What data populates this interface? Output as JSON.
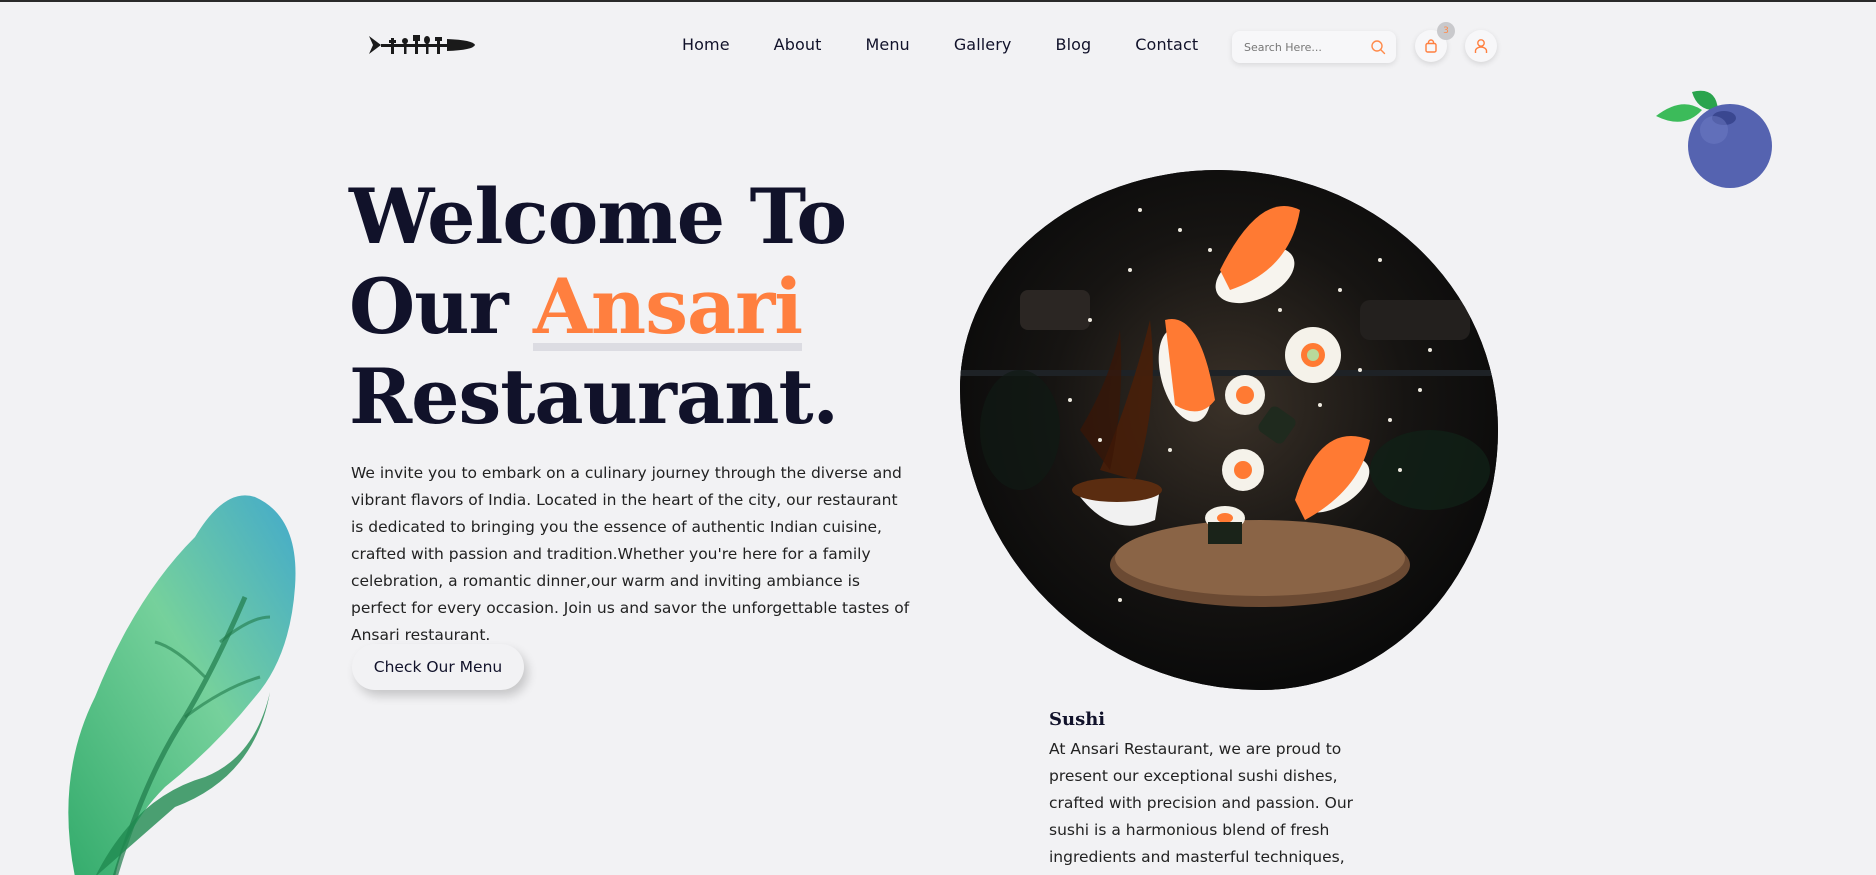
{
  "header": {
    "logo_icon": "utensils-logo-icon",
    "nav": [
      "Home",
      "About",
      "Menu",
      "Gallery",
      "Blog",
      "Contact"
    ],
    "search_placeholder": "Search Here...",
    "cart_count": "3"
  },
  "hero": {
    "title_line1": "Welcome To",
    "title_line2_prefix": "Our ",
    "title_accent": "Ansari",
    "title_line3": "Restaurant.",
    "description": "We invite you to embark on a culinary journey through the diverse and vibrant flavors of India. Located in the heart of the city, our restaurant is dedicated to bringing you the essence of authentic Indian cuisine, crafted with passion and tradition.Whether you're here for a family celebration, a romantic dinner,our warm and inviting ambiance is perfect for every occasion. Join us and savor the unforgettable tastes of Ansari restaurant.",
    "cta": "Check Our Menu"
  },
  "feature": {
    "title": "Sushi",
    "description": "At Ansari Restaurant, we are proud to present our exceptional sushi dishes, crafted with precision and passion. Our sushi is a harmonious blend of fresh ingredients and masterful techniques,"
  },
  "colors": {
    "accent": "#ff7f3f",
    "dark": "#11122a",
    "background": "#f2f2f4"
  }
}
